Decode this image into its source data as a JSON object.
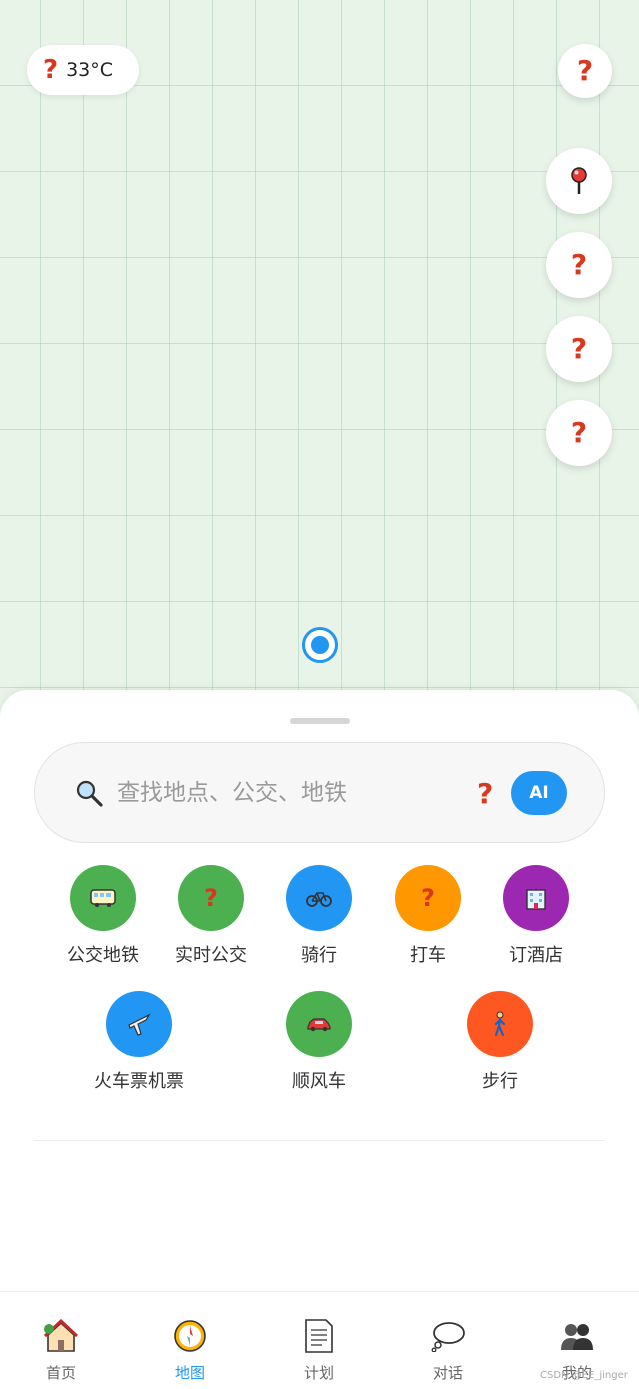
{
  "map": {
    "weather": {
      "icon": "question-icon",
      "temperature": "33°C"
    },
    "top_right_button": {
      "icon": "question-icon"
    },
    "side_buttons": [
      {
        "icon": "map-pin-icon"
      },
      {
        "icon": "question-icon"
      },
      {
        "icon": "question-icon"
      },
      {
        "icon": "question-icon"
      }
    ],
    "locator": {
      "icon": "current-location-icon",
      "color": "#2196f3"
    }
  },
  "search": {
    "placeholder": "查找地点、公交、地铁",
    "ai_label": "AI",
    "accent": "#2196f3"
  },
  "services": [
    {
      "label": "公交地铁",
      "icon": "bus-icon",
      "color": "#4caf50"
    },
    {
      "label": "实时公交",
      "icon": "question-icon",
      "color": "#4caf50"
    },
    {
      "label": "骑行",
      "icon": "bicycle-icon",
      "color": "#2196f3"
    },
    {
      "label": "打车",
      "icon": "question-icon",
      "color": "#ff9800"
    },
    {
      "label": "订酒店",
      "icon": "hotel-icon",
      "color": "#9c27b0"
    },
    {
      "label": "火车票机票",
      "icon": "airplane-icon",
      "color": "#2196f3"
    },
    {
      "label": "顺风车",
      "icon": "car-icon",
      "color": "#4caf50"
    },
    {
      "label": "步行",
      "icon": "walking-icon",
      "color": "#ff5722"
    }
  ],
  "tabs": [
    {
      "label": "首页",
      "icon": "home-icon",
      "active": false
    },
    {
      "label": "地图",
      "icon": "compass-icon",
      "active": true
    },
    {
      "label": "计划",
      "icon": "document-icon",
      "active": false
    },
    {
      "label": "对话",
      "icon": "speech-bubble-icon",
      "active": false
    },
    {
      "label": "我的",
      "icon": "users-icon",
      "active": false
    }
  ],
  "watermark": "CSDN @EE_jinger"
}
